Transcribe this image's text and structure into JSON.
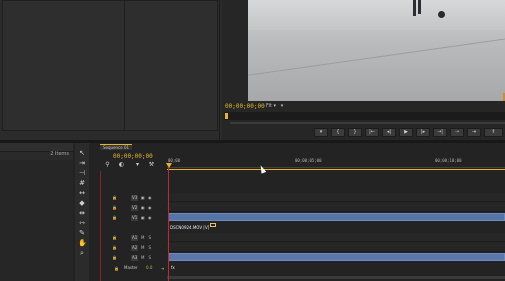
{
  "project": {
    "items_count": "2 Items"
  },
  "program": {
    "timecode": "00;00;00;00",
    "fit_value": "Fit",
    "controls": [
      "marker",
      "in",
      "out",
      "go-in",
      "step-back",
      "play",
      "step-forward",
      "go-out",
      "insert",
      "overwrite",
      "lift",
      "extract"
    ]
  },
  "timeline": {
    "tab_label": "Sequence 01",
    "timecode": "00;00;00;00",
    "ruler_ticks": [
      "00;00",
      "00;00;05;00",
      "00;00;10;00"
    ],
    "tracks": [
      {
        "name": "V3",
        "clip": ""
      },
      {
        "name": "V2",
        "clip": ""
      },
      {
        "name": "V1",
        "clip": "DSCN0924.MOV [V]"
      },
      {
        "name": "A1",
        "clip": ""
      },
      {
        "name": "A2",
        "clip": ""
      },
      {
        "name": "A3",
        "clip": "fx"
      }
    ],
    "master_label": "Master",
    "master_value": "0.0"
  }
}
